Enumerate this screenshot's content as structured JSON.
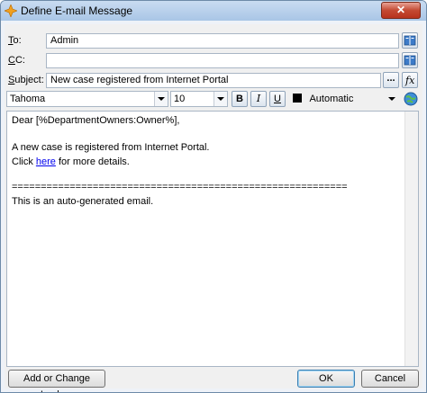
{
  "window": {
    "title": "Define E-mail Message",
    "close_glyph": "✕"
  },
  "fields": {
    "to": {
      "label_accel": "T",
      "label_rest": "o:",
      "value": "Admin"
    },
    "cc": {
      "label_accel": "C",
      "label_rest": "C:",
      "value": ""
    },
    "subject": {
      "label_accel": "S",
      "label_rest": "ubject:",
      "value": "New case registered from Internet Portal"
    }
  },
  "toolbar": {
    "ellipsis_label": "...",
    "font": "Tahoma",
    "size": "10",
    "bold": "B",
    "italic": "I",
    "underline": "U",
    "color_label": "Automatic",
    "colors": {
      "swatch": "#000000"
    }
  },
  "body": {
    "greeting": "Dear [%DepartmentOwners:Owner%],",
    "line1": "A new case is registered from Internet Portal.",
    "line2_prefix": "Click ",
    "line2_link": "here",
    "line2_suffix": " for more details.",
    "separator": "==========================================================",
    "footer": "This is an auto-generated email."
  },
  "buttons": {
    "lookup": "Add or Change Lookup",
    "ok": "OK",
    "cancel": "Cancel"
  }
}
